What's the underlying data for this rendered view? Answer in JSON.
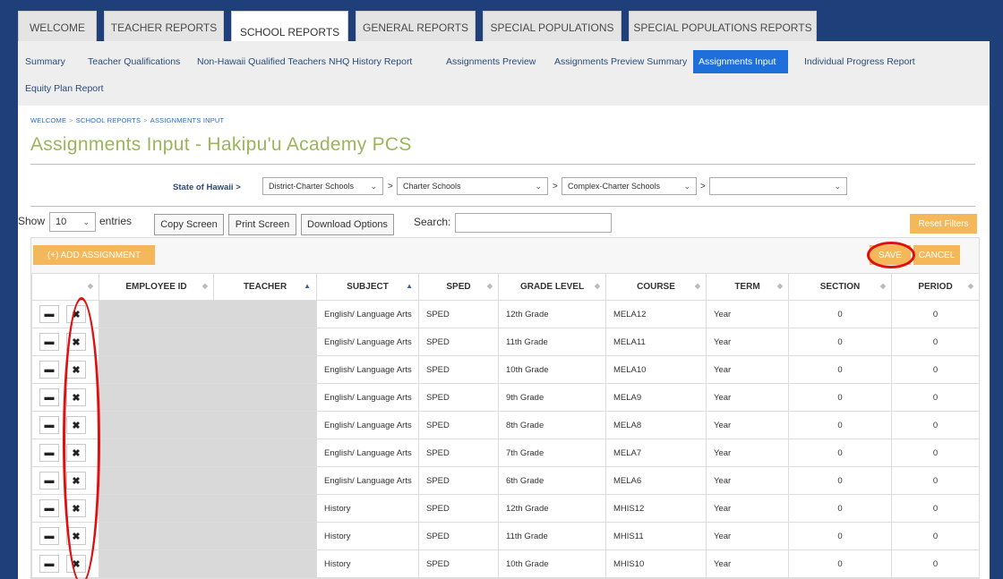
{
  "top_tabs": [
    "WELCOME",
    "TEACHER REPORTS",
    "SCHOOL REPORTS",
    "GENERAL REPORTS",
    "SPECIAL POPULATIONS",
    "SPECIAL POPULATIONS REPORTS"
  ],
  "sub_nav": [
    "Summary",
    "Teacher Qualifications",
    "Non-Hawaii Qualified Teachers",
    "NHQ History Report",
    "Assignments Preview",
    "Assignments Preview Summary",
    "Assignments Input",
    "Individual Progress Report",
    "Equity Plan Report"
  ],
  "breadcrumb": {
    "welcome": "WELCOME",
    "school_reports": "SCHOOL REPORTS",
    "current": "ASSIGNMENTS INPUT",
    "sep": ">"
  },
  "page_title": "Assignments Input - Hakipu'u Academy PCS",
  "filters": {
    "state_label": "State of Hawaii >",
    "gt": ">",
    "district": "District-Charter Schools",
    "school": "Charter Schools",
    "complex": "Complex-Charter Schools",
    "extra": ""
  },
  "controls": {
    "show": "Show",
    "entries_value": "10",
    "entries": "entries",
    "copy_screen": "Copy Screen",
    "print_screen": "Print Screen",
    "download_options": "Download Options",
    "search_label": "Search:",
    "search_value": "",
    "reset_filters": "Reset Filters",
    "add_assignment": "(+) ADD ASSIGNMENT",
    "save": "SAVE",
    "cancel": "CANCEL"
  },
  "table": {
    "headers": [
      "EMPLOYEE ID",
      "TEACHER",
      "SUBJECT",
      "SPED",
      "GRADE LEVEL",
      "COURSE",
      "TERM",
      "SECTION",
      "PERIOD"
    ],
    "rows": [
      {
        "subject": "English/ Language Arts",
        "sped": "SPED",
        "grade": "12th Grade",
        "course": "MELA12",
        "term": "Year",
        "section": "0",
        "period": "0"
      },
      {
        "subject": "English/ Language Arts",
        "sped": "SPED",
        "grade": "11th Grade",
        "course": "MELA11",
        "term": "Year",
        "section": "0",
        "period": "0"
      },
      {
        "subject": "English/ Language Arts",
        "sped": "SPED",
        "grade": "10th Grade",
        "course": "MELA10",
        "term": "Year",
        "section": "0",
        "period": "0"
      },
      {
        "subject": "English/ Language Arts",
        "sped": "SPED",
        "grade": "9th Grade",
        "course": "MELA9",
        "term": "Year",
        "section": "0",
        "period": "0"
      },
      {
        "subject": "English/ Language Arts",
        "sped": "SPED",
        "grade": "8th Grade",
        "course": "MELA8",
        "term": "Year",
        "section": "0",
        "period": "0"
      },
      {
        "subject": "English/ Language Arts",
        "sped": "SPED",
        "grade": "7th Grade",
        "course": "MELA7",
        "term": "Year",
        "section": "0",
        "period": "0"
      },
      {
        "subject": "English/ Language Arts",
        "sped": "SPED",
        "grade": "6th Grade",
        "course": "MELA6",
        "term": "Year",
        "section": "0",
        "period": "0"
      },
      {
        "subject": "History",
        "sped": "SPED",
        "grade": "12th Grade",
        "course": "MHIS12",
        "term": "Year",
        "section": "0",
        "period": "0"
      },
      {
        "subject": "History",
        "sped": "SPED",
        "grade": "11th Grade",
        "course": "MHIS11",
        "term": "Year",
        "section": "0",
        "period": "0"
      },
      {
        "subject": "History",
        "sped": "SPED",
        "grade": "10th Grade",
        "course": "MHIS10",
        "term": "Year",
        "section": "0",
        "period": "0"
      }
    ]
  },
  "icons": {
    "edit": "document-icon",
    "delete": "close-icon"
  },
  "colors": {
    "nav_bg": "#1f3f7a",
    "active_sub": "#1e6fd9",
    "title": "#9bb55a",
    "orange": "#f4b85a",
    "annotation": "#e01010"
  }
}
